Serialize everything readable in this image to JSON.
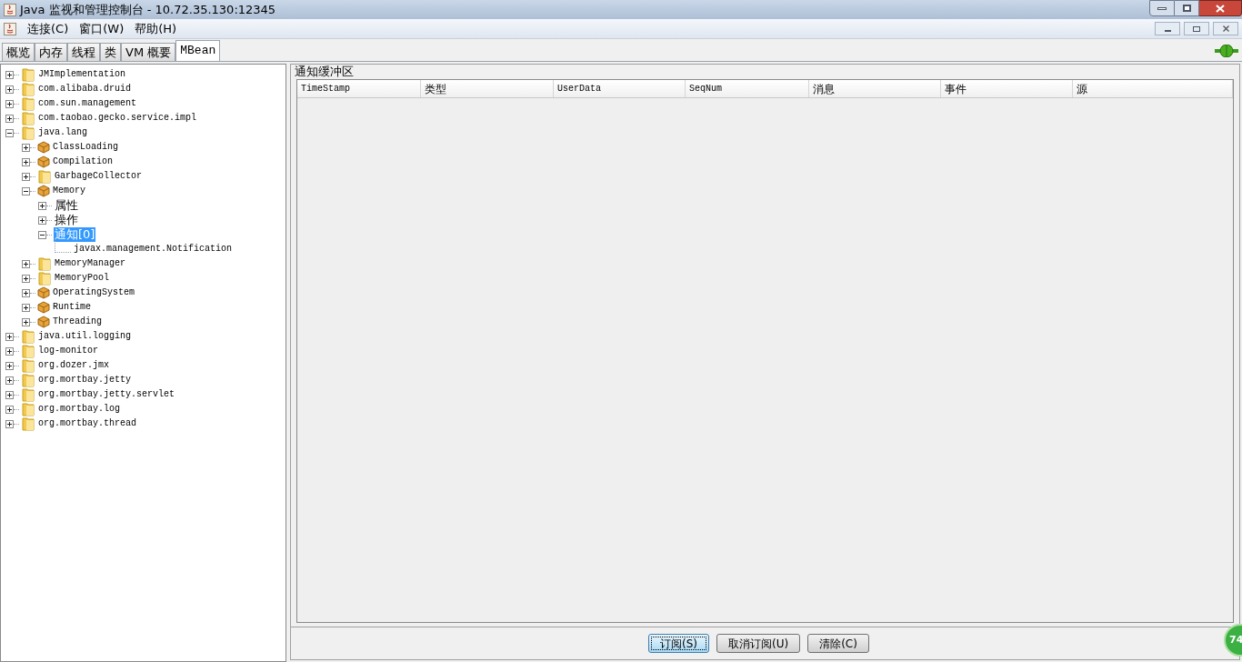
{
  "window": {
    "title": "Java 监视和管理控制台 - 10.72.35.130:12345"
  },
  "menu": [
    "连接(C)",
    "窗口(W)",
    "帮助(H)"
  ],
  "tabs": [
    {
      "label": "概览",
      "selected": false
    },
    {
      "label": "内存",
      "selected": false
    },
    {
      "label": "线程",
      "selected": false
    },
    {
      "label": "类",
      "selected": false
    },
    {
      "label": "VM 概要",
      "selected": false
    },
    {
      "label": "MBean",
      "selected": true
    }
  ],
  "tree": [
    {
      "label": "JMImplementation",
      "kind": "folder",
      "expanded": false,
      "selected": false
    },
    {
      "label": "com.alibaba.druid",
      "kind": "folder",
      "expanded": false,
      "selected": false
    },
    {
      "label": "com.sun.management",
      "kind": "folder",
      "expanded": false,
      "selected": false
    },
    {
      "label": "com.taobao.gecko.service.impl",
      "kind": "folder",
      "expanded": false,
      "selected": false
    },
    {
      "label": "java.lang",
      "kind": "folder",
      "expanded": true,
      "selected": false,
      "children": [
        {
          "label": "ClassLoading",
          "kind": "bean",
          "expanded": false,
          "selected": false
        },
        {
          "label": "Compilation",
          "kind": "bean",
          "expanded": false,
          "selected": false
        },
        {
          "label": "GarbageCollector",
          "kind": "folder",
          "expanded": false,
          "selected": false
        },
        {
          "label": "Memory",
          "kind": "bean",
          "expanded": true,
          "selected": false,
          "children": [
            {
              "label": "属性",
              "kind": "group",
              "expanded": false,
              "selected": false
            },
            {
              "label": "操作",
              "kind": "group",
              "expanded": false,
              "selected": false
            },
            {
              "label": "通知[0]",
              "kind": "group",
              "expanded": true,
              "selected": true,
              "children": [
                {
                  "label": "javax.management.Notification",
                  "kind": "leaf",
                  "selected": false
                }
              ]
            }
          ]
        },
        {
          "label": "MemoryManager",
          "kind": "folder",
          "expanded": false,
          "selected": false
        },
        {
          "label": "MemoryPool",
          "kind": "folder",
          "expanded": false,
          "selected": false
        },
        {
          "label": "OperatingSystem",
          "kind": "bean",
          "expanded": false,
          "selected": false
        },
        {
          "label": "Runtime",
          "kind": "bean",
          "expanded": false,
          "selected": false
        },
        {
          "label": "Threading",
          "kind": "bean",
          "expanded": false,
          "selected": false
        }
      ]
    },
    {
      "label": "java.util.logging",
      "kind": "folder",
      "expanded": false,
      "selected": false
    },
    {
      "label": "log-monitor",
      "kind": "folder",
      "expanded": false,
      "selected": false
    },
    {
      "label": "org.dozer.jmx",
      "kind": "folder",
      "expanded": false,
      "selected": false
    },
    {
      "label": "org.mortbay.jetty",
      "kind": "folder",
      "expanded": false,
      "selected": false
    },
    {
      "label": "org.mortbay.jetty.servlet",
      "kind": "folder",
      "expanded": false,
      "selected": false
    },
    {
      "label": "org.mortbay.log",
      "kind": "folder",
      "expanded": false,
      "selected": false
    },
    {
      "label": "org.mortbay.thread",
      "kind": "folder",
      "expanded": false,
      "selected": false
    }
  ],
  "notification_buffer": {
    "title": "通知缓冲区",
    "columns": [
      "TimeStamp",
      "类型",
      "UserData",
      "SeqNum",
      "消息",
      "事件",
      "源"
    ]
  },
  "buttons": [
    {
      "label": "订阅(S)",
      "focused": true
    },
    {
      "label": "取消订阅(U)",
      "focused": false
    },
    {
      "label": "清除(C)",
      "focused": false
    }
  ],
  "floating_badge": "74"
}
